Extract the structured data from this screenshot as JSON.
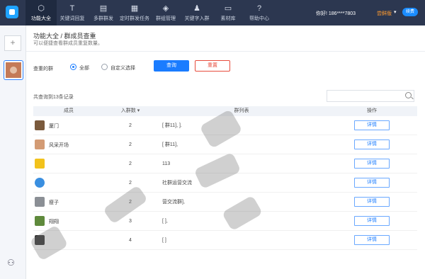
{
  "nav": [
    {
      "label": "功能大全",
      "icon": "box-icon",
      "active": true
    },
    {
      "label": "关键词回复",
      "icon": "text-icon",
      "active": false
    },
    {
      "label": "多群群发",
      "icon": "message-stack-icon",
      "active": false
    },
    {
      "label": "定时群发任务",
      "icon": "calendar-icon",
      "active": false
    },
    {
      "label": "群组管理",
      "icon": "layers-icon",
      "active": false
    },
    {
      "label": "关键字入群",
      "icon": "user-add-icon",
      "active": false
    },
    {
      "label": "素材库",
      "icon": "folder-icon",
      "active": false
    },
    {
      "label": "帮助中心",
      "icon": "help-icon",
      "active": false
    }
  ],
  "user": {
    "greeting": "你好! 186****7803",
    "vip": "尝鲜版",
    "renew": "续费"
  },
  "page": {
    "title": "功能大全 / 群成员查重",
    "subtitle": "可以便捷查看群成员重复数量。"
  },
  "filter": {
    "label": "查重的群",
    "option_all": "全部",
    "option_custom": "自定义选择",
    "query": "查询",
    "reset": "重置"
  },
  "results": {
    "count": "共查询到13条记录"
  },
  "table": {
    "headers": {
      "member": "成员",
      "groups": "入群数 ▾",
      "group_list": "群列表",
      "action": "操作"
    },
    "rows": [
      {
        "name": "厦门",
        "count": "2",
        "groups": "[       群11],        ].",
        "action": "详情",
        "avatar_color": "#7a5a3c"
      },
      {
        "name": "风采开场",
        "count": "2",
        "groups": "[       群11],",
        "action": "详情",
        "avatar_color": "#d39b74"
      },
      {
        "name": "",
        "count": "2",
        "groups": "           113",
        "action": "详情",
        "avatar_color": "#f2c21c"
      },
      {
        "name": "",
        "count": "2",
        "groups": "      社群运营交流",
        "action": "详情",
        "avatar_color": "#3a8fe0"
      },
      {
        "name": "瘦子",
        "count": "2",
        "groups": "             营交流群],",
        "action": "详情",
        "avatar_color": "#8b8f95"
      },
      {
        "name": "翔翔",
        "count": "3",
        "groups": "[                                          ],",
        "action": "详情",
        "avatar_color": "#5f8a3c"
      },
      {
        "name": "",
        "count": "4",
        "groups": "[                                             ]",
        "action": "详情",
        "avatar_color": "#333333"
      }
    ]
  },
  "sidebar": {
    "add": "+"
  }
}
